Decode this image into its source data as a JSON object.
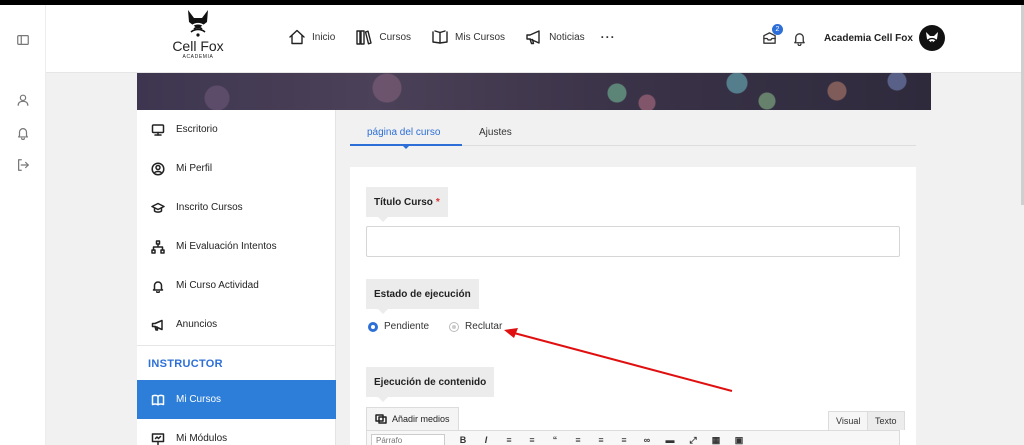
{
  "header": {
    "logo_name": "Cell Fox",
    "logo_sub": "ACADEMIA",
    "nav": [
      {
        "label": "Inicio",
        "icon": "home-icon"
      },
      {
        "label": "Cursos",
        "icon": "books-icon"
      },
      {
        "label": "Mis Cursos",
        "icon": "open-book-icon"
      },
      {
        "label": "Noticias",
        "icon": "megaphone-icon"
      }
    ],
    "more_label": "···",
    "notification_count": "2",
    "user_name": "Academia Cell Fox"
  },
  "sidebar": {
    "items": [
      {
        "label": "Escritorio",
        "icon": "monitor-icon"
      },
      {
        "label": "Mi Perfil",
        "icon": "user-circle-icon"
      },
      {
        "label": "Inscrito Cursos",
        "icon": "graduation-cap-icon"
      },
      {
        "label": "Mi Evaluación Intentos",
        "icon": "sitemap-icon"
      },
      {
        "label": "Mi Curso Actividad",
        "icon": "bell-icon"
      },
      {
        "label": "Anuncios",
        "icon": "megaphone-icon"
      }
    ],
    "section_title": "INSTRUCTOR",
    "instructor_items": [
      {
        "label": "Mi Cursos",
        "icon": "book-icon",
        "active": true
      },
      {
        "label": "Mi Módulos",
        "icon": "presentation-icon"
      }
    ]
  },
  "tabs": [
    {
      "label": "página del curso",
      "active": true
    },
    {
      "label": "Ajustes"
    }
  ],
  "form": {
    "title_label": "Título Curso",
    "required_mark": "*",
    "title_value": "",
    "status_label": "Estado de ejecución",
    "status_options": [
      {
        "label": "Pendiente",
        "selected": true
      },
      {
        "label": "Reclutar",
        "selected": false
      }
    ],
    "content_label": "Ejecución de contenido",
    "add_media_label": "Añadir medios",
    "editor_tabs": {
      "visual": "Visual",
      "text": "Texto"
    },
    "paragraph_select": "Párrafo"
  },
  "colors": {
    "accent": "#2d6fd6",
    "active_item": "#2d7ed9",
    "annotation_arrow": "#e01010"
  }
}
